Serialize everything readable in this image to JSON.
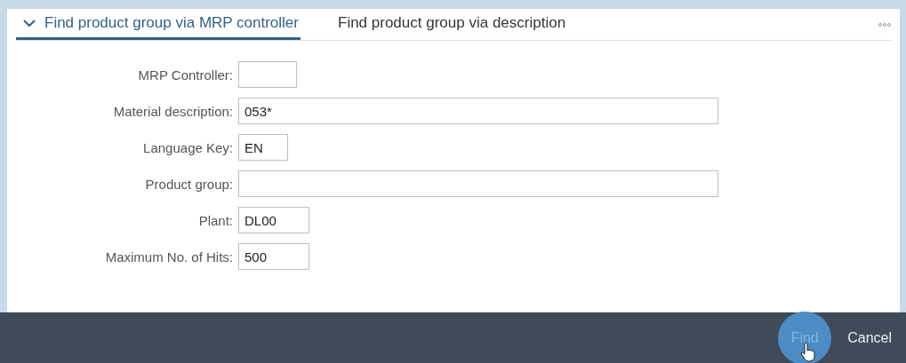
{
  "tabs": [
    {
      "label": "Find product group via MRP controller",
      "selected": true,
      "expanded": true
    },
    {
      "label": "Find product group via description",
      "selected": false,
      "expanded": false
    }
  ],
  "fields": [
    {
      "label": "MRP Controller:",
      "kind": "small"
    },
    {
      "label": "Material description:",
      "value": "053*",
      "kind": "wide"
    },
    {
      "label": "Language Key:",
      "value": "EN",
      "kind": "tiny"
    },
    {
      "label": "Product group:",
      "kind": "wide"
    },
    {
      "label": "Plant:",
      "value": "DL00",
      "kind": "medium"
    },
    {
      "label": "Maximum No. of Hits:",
      "value": "500",
      "kind": "medium"
    }
  ],
  "footer_buttons": [
    {
      "label": "Find",
      "kind": "emphasized"
    },
    {
      "label": "Cancel",
      "kind": "plain"
    }
  ]
}
